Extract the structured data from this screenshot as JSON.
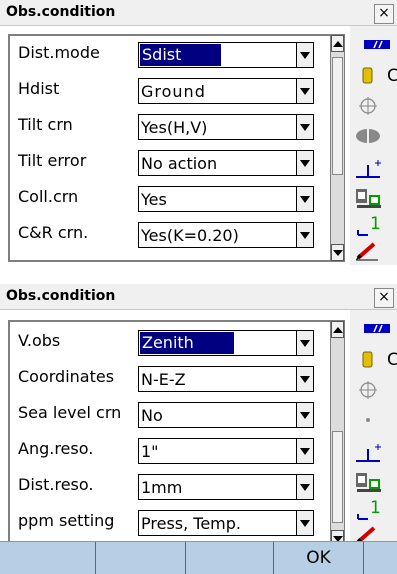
{
  "window1": {
    "title": "Obs.condition",
    "close": "×",
    "rows": [
      {
        "label": "Dist.mode",
        "value": "Sdist",
        "highlighted": true
      },
      {
        "label": "Hdist",
        "value": "Ground"
      },
      {
        "label": "Tilt crn",
        "value": "Yes(H,V)"
      },
      {
        "label": "Tilt error",
        "value": "No action"
      },
      {
        "label": "Coll.crn",
        "value": "Yes"
      },
      {
        "label": "C&R crn.",
        "value": "Yes(K=0.20)"
      }
    ],
    "status_text": "C",
    "tilt_value": "1"
  },
  "window2": {
    "title": "Obs.condition",
    "close": "×",
    "rows": [
      {
        "label": "V.obs",
        "value": "Zenith",
        "highlighted": true
      },
      {
        "label": "Coordinates",
        "value": "N-E-Z"
      },
      {
        "label": "Sea level crn",
        "value": "No"
      },
      {
        "label": "Ang.reso.",
        "value": "1\""
      },
      {
        "label": "Dist.reso.",
        "value": "1mm"
      },
      {
        "label": "ppm setting",
        "value": "Press, Temp."
      }
    ],
    "status_text": "C",
    "tilt_value": "1"
  },
  "softkeys": [
    "",
    "",
    "",
    "OK",
    ""
  ],
  "colors": {
    "highlight": "#000080",
    "softkey_bar": "#b7cfe4",
    "battery": "#e0c000",
    "icon_blue": "#0000c0",
    "icon_red": "#d00000",
    "icon_green": "#00a000"
  },
  "icons": [
    "signal-icon",
    "battery-icon",
    "target-icon",
    "prism-icon",
    "tilt-icon",
    "instrument-icon",
    "level-icon",
    "pen-icon"
  ]
}
